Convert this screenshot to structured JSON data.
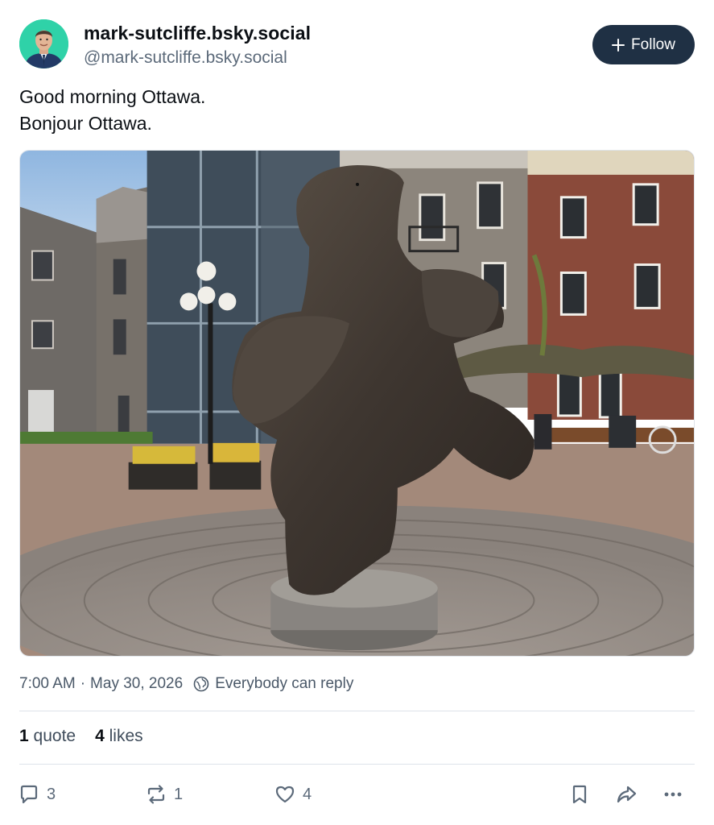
{
  "author": {
    "display_name": "mark-sutcliffe.bsky.social",
    "handle": "@mark-sutcliffe.bsky.social",
    "avatar": "profile-photo"
  },
  "follow_button": {
    "label": "Follow",
    "icon": "plus-icon"
  },
  "post": {
    "lines": [
      "Good morning Ottawa.",
      "Bonjour Ottawa."
    ],
    "image": "photo-bronze-dancing-bear-sculpture-cobblestone-courtyard"
  },
  "meta": {
    "time": "7:00 AM",
    "separator": "·",
    "date": "May 30, 2026",
    "reply_setting": "Everybody can reply",
    "reply_icon": "globe-icon"
  },
  "stats": {
    "quotes_count": "1",
    "quotes_label": "quote",
    "likes_count": "4",
    "likes_label": "likes"
  },
  "actions": {
    "reply_count": "3",
    "repost_count": "1",
    "like_count": "4",
    "icons": [
      "reply-icon",
      "repost-icon",
      "like-icon",
      "bookmark-icon",
      "share-icon",
      "more-icon"
    ]
  },
  "colors": {
    "follow_bg": "#1f3044",
    "muted_text": "#5c6a7a",
    "divider": "#dde3ea",
    "avatar_bg": "#2fd2a8"
  }
}
